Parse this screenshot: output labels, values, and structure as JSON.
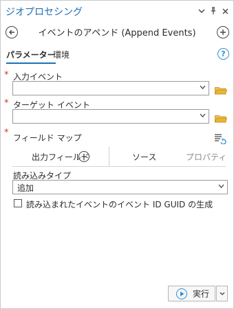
{
  "pane": {
    "title": "ジオプロセシング",
    "menu_glyph": "⌄",
    "pin_glyph": "📌",
    "close_glyph": "✕"
  },
  "tool": {
    "title": "イベントのアペンド (Append Events)"
  },
  "tabs": [
    {
      "label": "パラメーター",
      "active": true
    },
    {
      "label": "環境",
      "active": false
    }
  ],
  "help": {
    "glyph": "?"
  },
  "params": {
    "input_events": {
      "label": "入力イベント",
      "value": "",
      "required": true
    },
    "target_events": {
      "label": "ターゲット イベント",
      "value": "",
      "required": true
    },
    "field_map": {
      "label": "フィールド マップ",
      "required": true
    }
  },
  "field_map_tabs": {
    "output_fields": "出力フィールド",
    "source": "ソース",
    "properties": "プロパティ"
  },
  "load_type": {
    "label": "読み込みタイプ",
    "value": "追加"
  },
  "checkbox": {
    "label": "読み込まれたイベントのイベント ID GUID の生成",
    "checked": false
  },
  "run": {
    "label": "実行"
  },
  "colors": {
    "accent": "#1f6fb5",
    "required": "#c93a2c",
    "folder": "#e8b43a",
    "help": "#2d8fd5"
  },
  "icons": {
    "back": "back-arrow-icon",
    "add": "plus-circle-icon",
    "folder": "folder-icon",
    "list_reset": "list-reset-icon",
    "run": "play-icon"
  }
}
